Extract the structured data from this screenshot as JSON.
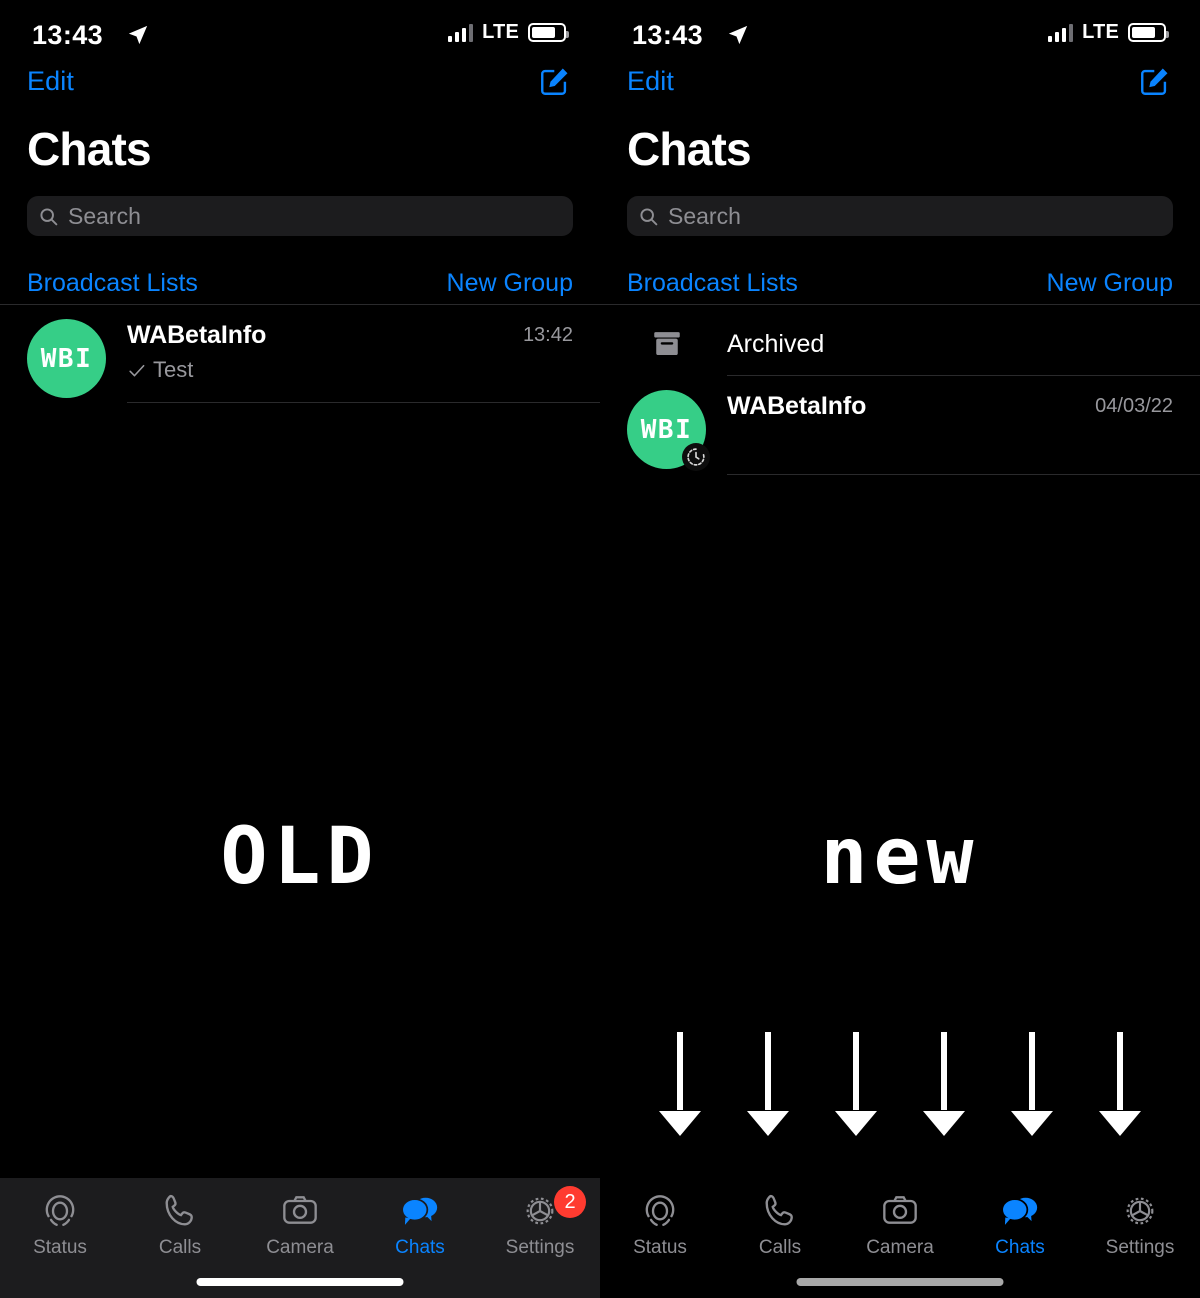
{
  "left": {
    "label": "OLD",
    "statusbar": {
      "time": "13:43",
      "location_icon": "location-arrow-icon",
      "signal_icon": "cellular-bars-icon",
      "network": "LTE",
      "battery_icon": "battery-icon"
    },
    "nav": {
      "edit_label": "Edit",
      "compose_icon": "compose-icon"
    },
    "title": "Chats",
    "search": {
      "placeholder": "Search",
      "icon": "search-icon"
    },
    "actions": {
      "broadcast_label": "Broadcast Lists",
      "new_group_label": "New Group"
    },
    "chats": [
      {
        "name": "WABetaInfo",
        "avatar_text": "WBI",
        "preview": "Test",
        "preview_icon": "check-icon",
        "time": "13:42",
        "has_timer_badge": false
      }
    ],
    "archived": null,
    "tabs": [
      {
        "label": "Status",
        "icon": "status-rings-icon",
        "active": false,
        "badge": null
      },
      {
        "label": "Calls",
        "icon": "phone-icon",
        "active": false,
        "badge": null
      },
      {
        "label": "Camera",
        "icon": "camera-icon",
        "active": false,
        "badge": null
      },
      {
        "label": "Chats",
        "icon": "chat-bubbles-icon",
        "active": true,
        "badge": null
      },
      {
        "label": "Settings",
        "icon": "gear-icon",
        "active": false,
        "badge": "2"
      }
    ],
    "tabbar_shaded": true,
    "home_indicator": "white"
  },
  "right": {
    "label": "new",
    "statusbar": {
      "time": "13:43",
      "location_icon": "location-arrow-icon",
      "signal_icon": "cellular-bars-icon",
      "network": "LTE",
      "battery_icon": "battery-icon"
    },
    "nav": {
      "edit_label": "Edit",
      "compose_icon": "compose-icon"
    },
    "title": "Chats",
    "search": {
      "placeholder": "Search",
      "icon": "search-icon"
    },
    "actions": {
      "broadcast_label": "Broadcast Lists",
      "new_group_label": "New Group"
    },
    "archived": {
      "label": "Archived",
      "icon": "archive-box-icon"
    },
    "chats": [
      {
        "name": "WABetaInfo",
        "avatar_text": "WBI",
        "preview": "",
        "preview_icon": null,
        "time": "04/03/22",
        "has_timer_badge": true
      }
    ],
    "tabs": [
      {
        "label": "Status",
        "icon": "status-rings-icon",
        "active": false,
        "badge": null
      },
      {
        "label": "Calls",
        "icon": "phone-icon",
        "active": false,
        "badge": null
      },
      {
        "label": "Camera",
        "icon": "camera-icon",
        "active": false,
        "badge": null
      },
      {
        "label": "Chats",
        "icon": "chat-bubbles-icon",
        "active": true,
        "badge": null
      },
      {
        "label": "Settings",
        "icon": "gear-icon",
        "active": false,
        "badge": null
      }
    ],
    "tabbar_shaded": false,
    "home_indicator": "gray",
    "arrows": {
      "icon": "down-arrow-icon",
      "count": 6
    }
  },
  "colors": {
    "accent": "#0a84ff",
    "badge": "#ff3b30",
    "avatar_green": "#36ce87",
    "secondary_text": "#98989d",
    "background": "#000000",
    "surface": "#1c1c1e"
  }
}
